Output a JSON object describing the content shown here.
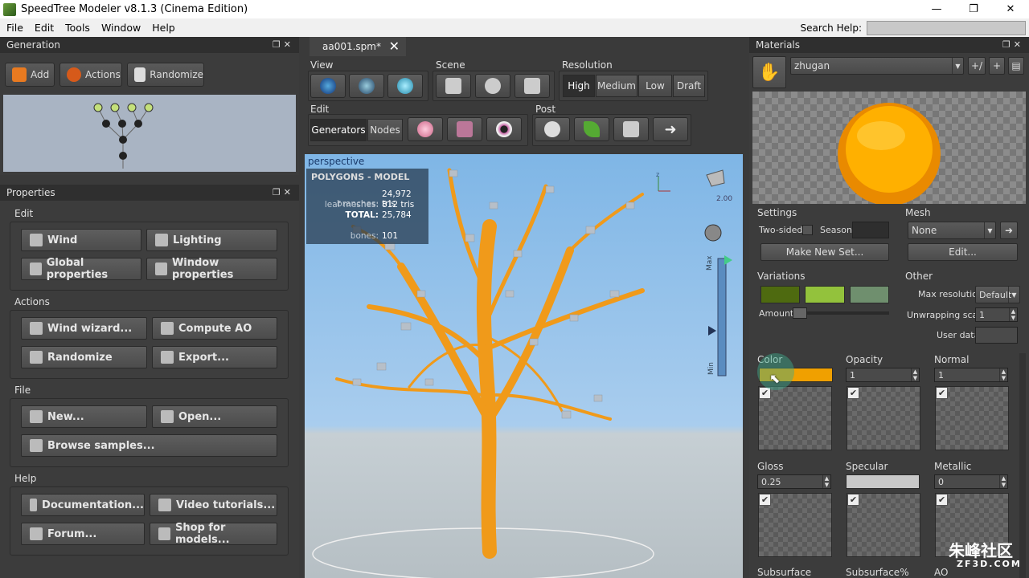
{
  "window": {
    "title": "SpeedTree Modeler v8.1.3 (Cinema Edition)",
    "min": "—",
    "max": "❐",
    "close": "✕"
  },
  "menu": [
    "File",
    "Edit",
    "Tools",
    "Window",
    "Help"
  ],
  "search_help": {
    "label": "Search Help:"
  },
  "generation": {
    "title": "Generation",
    "buttons": {
      "add": "Add",
      "actions": "Actions",
      "randomize": "Randomize"
    }
  },
  "properties": {
    "title": "Properties",
    "edit": {
      "label": "Edit",
      "wind": "Wind",
      "lighting": "Lighting",
      "global": "Global properties",
      "window": "Window properties"
    },
    "actions": {
      "label": "Actions",
      "wind_wizard": "Wind wizard...",
      "compute_ao": "Compute AO",
      "randomize": "Randomize",
      "export": "Export..."
    },
    "file": {
      "label": "File",
      "new": "New...",
      "open": "Open...",
      "browse": "Browse samples..."
    },
    "help": {
      "label": "Help",
      "docs": "Documentation...",
      "video": "Video tutorials...",
      "forum": "Forum...",
      "shop": "Shop for models..."
    }
  },
  "document": {
    "tab": "aa001.spm*",
    "close": "✕"
  },
  "toolbar": {
    "view": "View",
    "scene": "Scene",
    "resolution": "Resolution",
    "resolution_options": [
      "High",
      "Medium",
      "Low",
      "Draft"
    ],
    "edit": "Edit",
    "edit_modes": [
      "Generators",
      "Nodes"
    ],
    "post": "Post"
  },
  "viewport": {
    "label": "perspective",
    "stats_title": "POLYGONS - MODEL",
    "stats": [
      {
        "k": "branches:",
        "v": "24,972 tris"
      },
      {
        "k": "leaf meshes:",
        "v": "812 tris"
      },
      {
        "k": "TOTAL:",
        "v": "25,784"
      },
      {
        "k": "bones:",
        "v": "101"
      }
    ],
    "light_value": "2.00",
    "axis_z": "z",
    "lod_top": "Max",
    "lod_bottom": "Min"
  },
  "materials": {
    "title": "Materials",
    "name": "zhugan",
    "settings": {
      "label": "Settings",
      "two_sided": "Two-sided",
      "season": "Season",
      "make_new_set": "Make New Set..."
    },
    "mesh": {
      "label": "Mesh",
      "value": "None",
      "edit": "Edit..."
    },
    "variations": {
      "label": "Variations",
      "amount": "Amount",
      "colors": [
        "#4e6a10",
        "#93c23c",
        "#6f8f6e"
      ]
    },
    "other": {
      "label": "Other",
      "max_resolution": "Max resolution",
      "max_resolution_value": "Default",
      "unwrapping_scale": "Unwrapping scale",
      "unwrapping_value": "1",
      "user_data": "User data"
    },
    "maps": [
      {
        "label": "Color",
        "value": ""
      },
      {
        "label": "Opacity",
        "value": "1"
      },
      {
        "label": "Normal",
        "value": "1"
      },
      {
        "label": "Gloss",
        "value": "0.25"
      },
      {
        "label": "Specular",
        "value": ""
      },
      {
        "label": "Metallic",
        "value": "0"
      }
    ],
    "bottom_labels": [
      "Subsurface",
      "Subsurface%",
      "AO"
    ],
    "color_swatch": "#f0a000"
  },
  "watermark": {
    "brand": "朱峰社区",
    "site": "ZF3D.COM"
  }
}
